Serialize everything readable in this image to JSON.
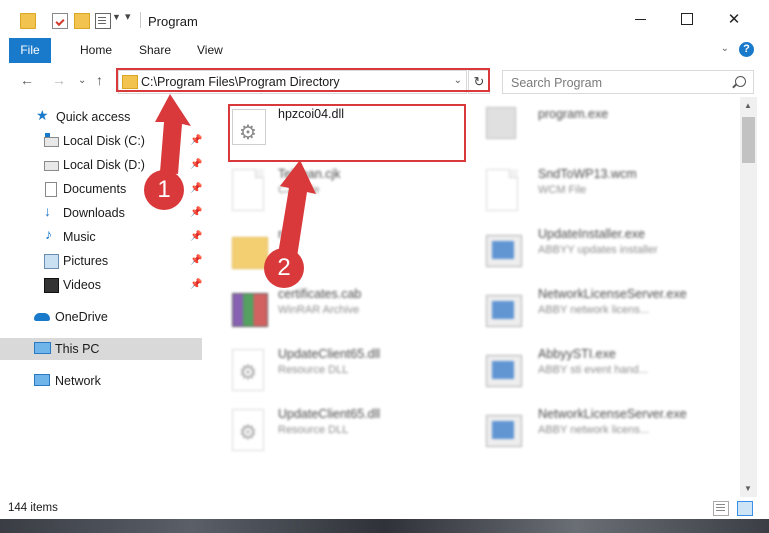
{
  "window": {
    "title": "Program"
  },
  "ribbon": {
    "tabs": [
      "File",
      "Home",
      "Share",
      "View"
    ],
    "help_label": "?"
  },
  "nav": {
    "address": "C:\\Program Files\\Program Directory",
    "search_placeholder": "Search Program"
  },
  "sidebar": {
    "items": [
      {
        "label": "Quick access",
        "icon": "star-icon",
        "pinned": false
      },
      {
        "label": "Local Disk (C:)",
        "icon": "drive-icon",
        "pinned": true
      },
      {
        "label": "Local Disk (D:)",
        "icon": "drive-icon",
        "pinned": true
      },
      {
        "label": "Documents",
        "icon": "documents-icon",
        "pinned": true
      },
      {
        "label": "Downloads",
        "icon": "download-icon",
        "pinned": true
      },
      {
        "label": "Music",
        "icon": "music-icon",
        "pinned": true
      },
      {
        "label": "Pictures",
        "icon": "pictures-icon",
        "pinned": true
      },
      {
        "label": "Videos",
        "icon": "videos-icon",
        "pinned": true
      },
      {
        "label": "OneDrive",
        "icon": "cloud-icon",
        "pinned": false
      },
      {
        "label": "This PC",
        "icon": "computer-icon",
        "pinned": false,
        "selected": true
      },
      {
        "label": "Network",
        "icon": "network-icon",
        "pinned": false
      }
    ]
  },
  "files": [
    {
      "name": "hpzcoi04.dll",
      "type": "",
      "icon": "dll-gear-icon",
      "highlighted": true
    },
    {
      "name": "program.exe",
      "type": "",
      "icon": "exe-icon"
    },
    {
      "name": "Telnean.cjk",
      "type": "CJK File",
      "icon": "blank-file-icon"
    },
    {
      "name": "SndToWP13.wcm",
      "type": "WCM File",
      "icon": "blank-file-icon"
    },
    {
      "name": "r4",
      "type": "",
      "icon": "folder-icon"
    },
    {
      "name": "UpdateInstaller.exe",
      "type": "ABBYY updates installer",
      "icon": "app-icon"
    },
    {
      "name": "certificates.cab",
      "type": "WinRAR Archive",
      "icon": "winrar-icon"
    },
    {
      "name": "NetworkLicenseServer.exe",
      "type": "ABBY network licens...",
      "icon": "app-icon"
    },
    {
      "name": "UpdateClient65.dll",
      "type": "Resource DLL",
      "icon": "dll-gear-icon"
    },
    {
      "name": "AbbyySTI.exe",
      "type": "ABBY sti event hand...",
      "icon": "app-icon"
    },
    {
      "name": "UpdateClient65.dll",
      "type": "Resource DLL",
      "icon": "dll-gear-icon"
    },
    {
      "name": "NetworkLicenseServer.exe",
      "type": "ABBY network licens...",
      "icon": "app-icon"
    }
  ],
  "status": {
    "item_count": "144 items"
  },
  "annotations": {
    "step1": "1",
    "step2": "2",
    "color": "#d9393b"
  }
}
